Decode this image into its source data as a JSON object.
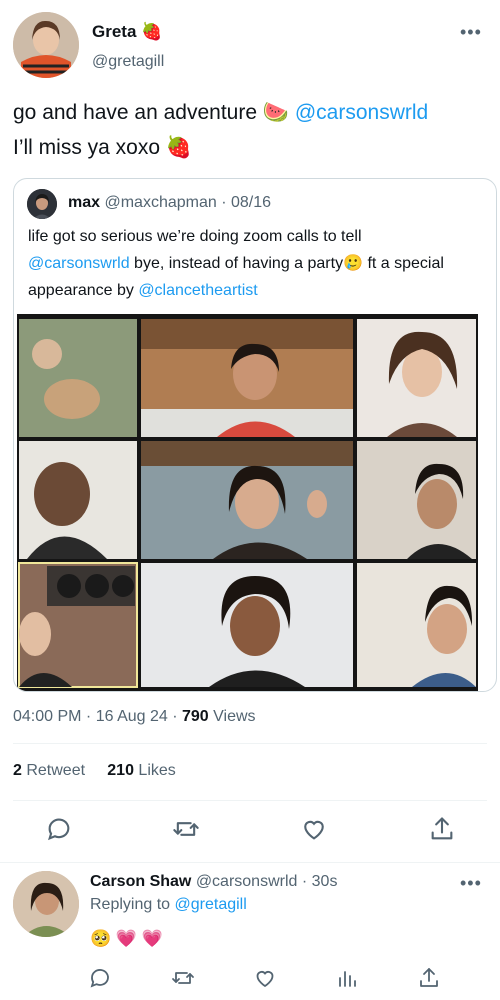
{
  "tweet": {
    "author_name": "Greta",
    "author_emoji": "🍓",
    "author_handle": "@gretagill",
    "text_line1": "go and have an adventure 🍉 ",
    "text_mention": "@carsonswrld",
    "text_line2": "I’ll miss ya xoxo 🍓",
    "timestamp": "04:00 PM · 16 Aug 24 · ",
    "views_count": "790",
    "views_label": " Views",
    "retweets_count": "2",
    "retweets_label": " Retweet",
    "likes_count": "210",
    "likes_label": " Likes"
  },
  "quote": {
    "name": "max",
    "handle": "@maxchapman",
    "date": "· 08/16",
    "text_part1": "life got so serious we’re doing zoom calls to tell",
    "mention1": "@carsonswrld",
    "text_part2": " bye, instead of having a party🥲  ft a special appearance by ",
    "mention2": "@clancetheartist"
  },
  "reply": {
    "name": "Carson Shaw",
    "handle": "@carsonswrld",
    "time": "· 30s",
    "replying_prefix": "Replying to ",
    "replying_handle": "@gretagill",
    "text": "🥺 💗 💗"
  },
  "colors": {
    "accent": "#1d9bf0",
    "secondary_text": "#536471",
    "primary_text": "#0f1419",
    "border": "#cfd9de"
  },
  "icons": [
    "more-icon",
    "reply-icon",
    "retweet-icon",
    "like-icon",
    "share-icon",
    "analytics-icon"
  ]
}
